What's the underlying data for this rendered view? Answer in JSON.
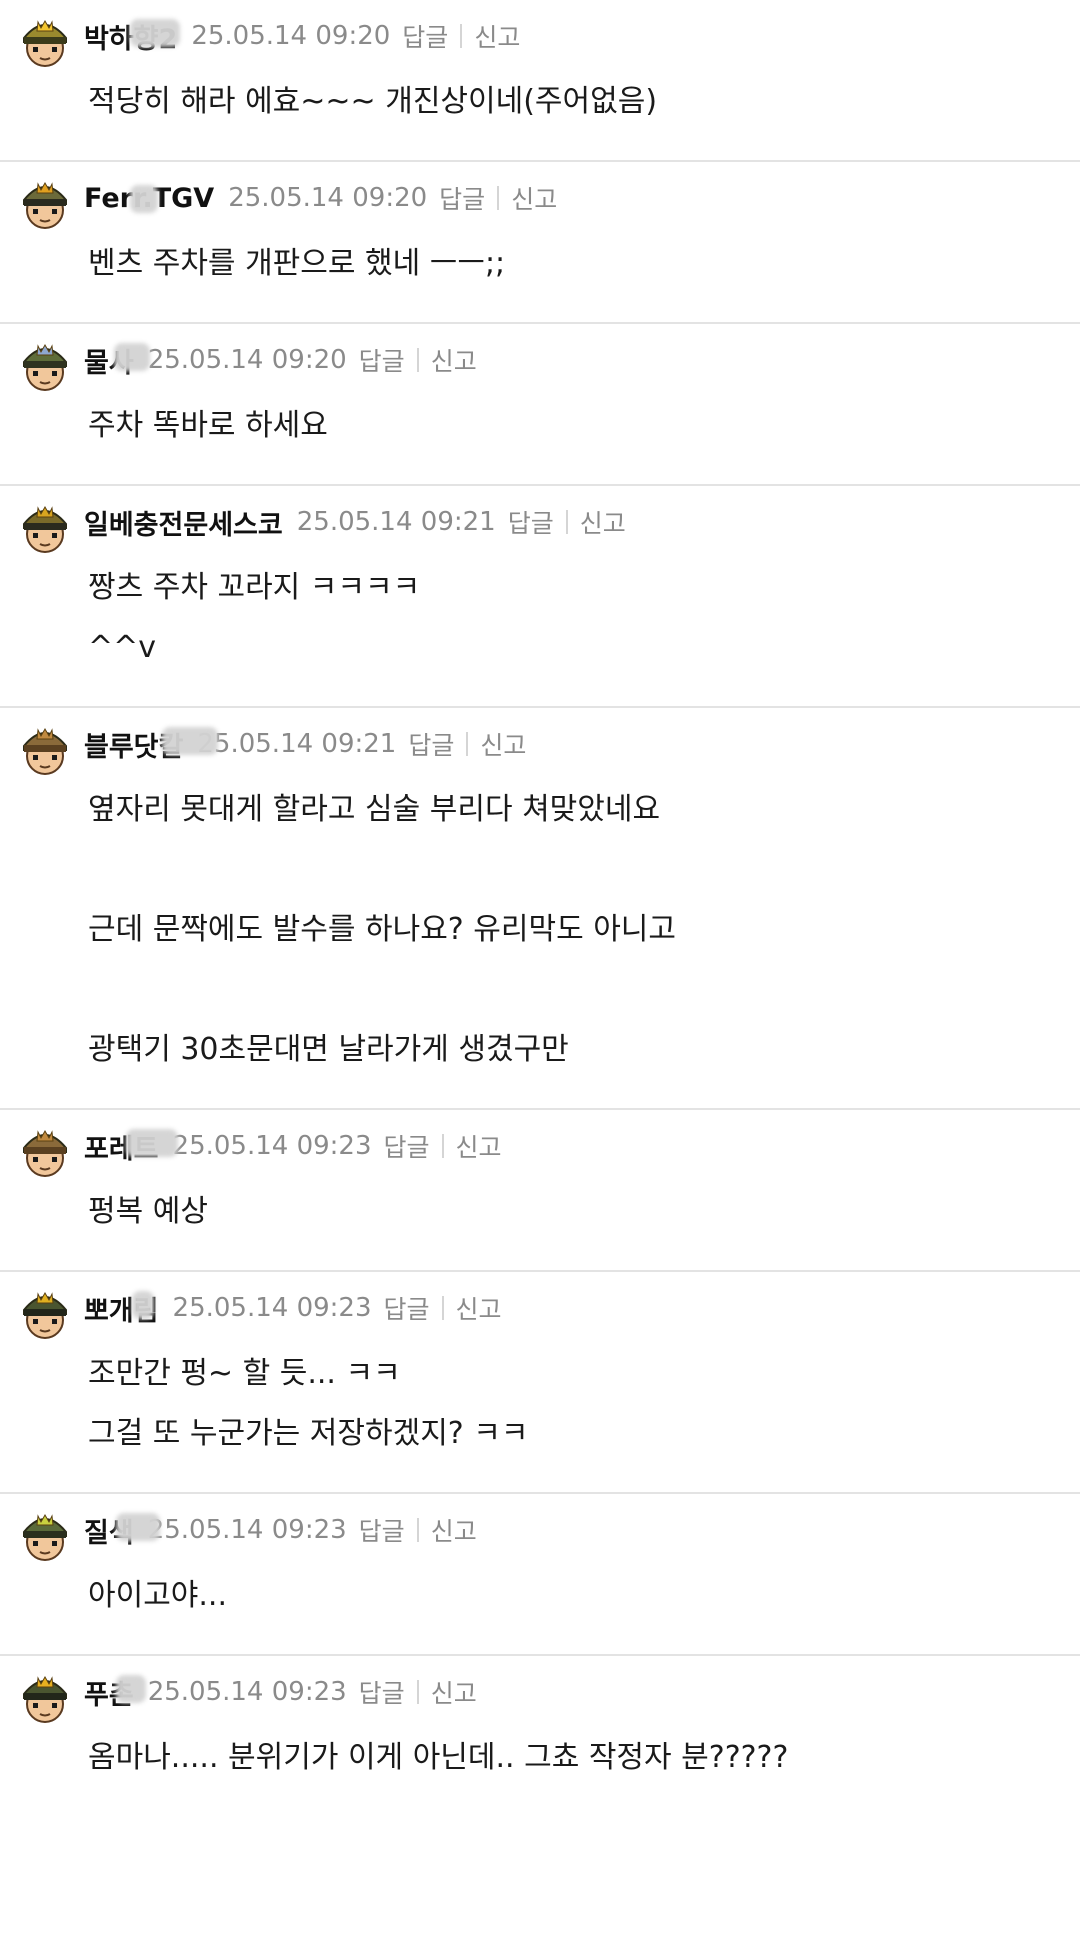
{
  "actions": {
    "reply": "답글",
    "report": "신고"
  },
  "comments": [
    {
      "nick": "박하향2",
      "time": "25.05.14 09:20",
      "lines": [
        "적당히 해라 에효~~~ 개진상이네(주어없음)"
      ]
    },
    {
      "nick": "Ferr.TGV",
      "time": "25.05.14 09:20",
      "lines": [
        "벤츠 주차를 개판으로 했네 ㅡㅡ;;"
      ]
    },
    {
      "nick": "물사",
      "time": "25.05.14 09:20",
      "lines": [
        "주차 똑바로 하세요"
      ]
    },
    {
      "nick": "일베충전문세스코",
      "time": "25.05.14 09:21",
      "lines": [
        "짱츠 주차 꼬라지 ㅋㅋㅋㅋ",
        "^^v"
      ]
    },
    {
      "nick": "블루닷칼",
      "time": "25.05.14 09:21",
      "lines": [
        "옆자리 못대게 할라고 심술 부리다 쳐맞았네요",
        "",
        "근데 문짝에도 발수를 하나요? 유리막도 아니고",
        "",
        "광택기 30초문대면 날라가게 생겼구만"
      ]
    },
    {
      "nick": "포레트",
      "time": "25.05.14 09:23",
      "lines": [
        "펑복 예상"
      ]
    },
    {
      "nick": "뽀개림",
      "time": "25.05.14 09:23",
      "lines": [
        "조만간 펑~ 할 듯... ㅋㅋ",
        "그걸 또 누군가는 저장하겠지? ㅋㅋ"
      ]
    },
    {
      "nick": "질색",
      "time": "25.05.14 09:23",
      "lines": [
        "아이고야..."
      ]
    },
    {
      "nick": "푸촌",
      "time": "25.05.14 09:23",
      "lines": [
        "옴마나..... 분위기가 이게 아닌데.. 그쵸 작정자 분?????"
      ]
    }
  ]
}
